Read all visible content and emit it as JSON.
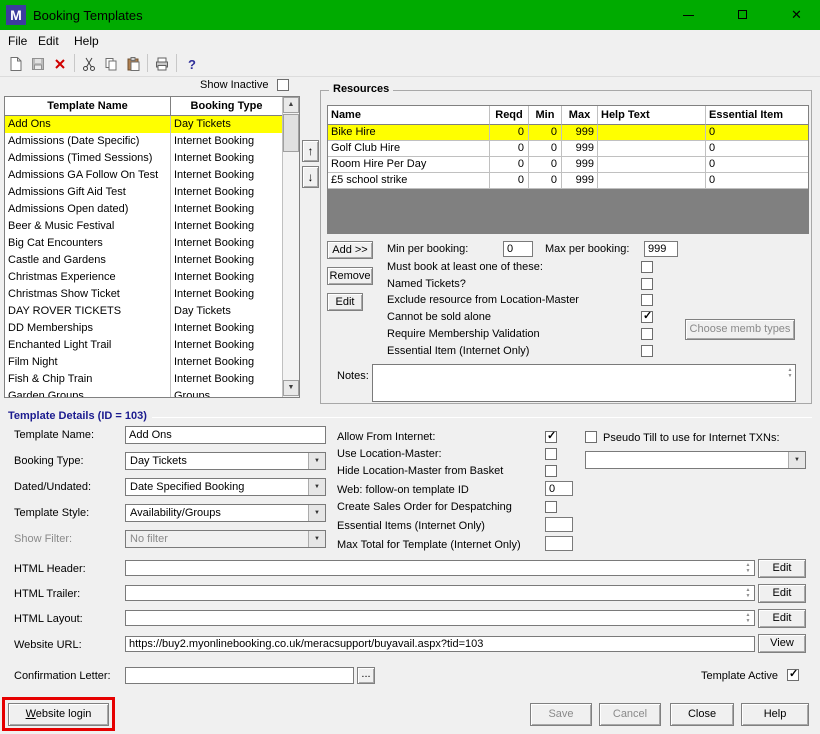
{
  "window": {
    "title": "Booking Templates",
    "logo_letter": "M"
  },
  "menu": {
    "items": [
      {
        "label": "File"
      },
      {
        "label": "Edit"
      },
      {
        "label": "Help"
      }
    ]
  },
  "toolbar": {
    "icons": [
      "new-document",
      "save",
      "delete",
      "cut",
      "copy",
      "paste",
      "print",
      "help"
    ]
  },
  "left_panel": {
    "show_inactive_label": "Show Inactive",
    "show_inactive_checked": false,
    "columns": [
      "Template Name",
      "Booking Type"
    ],
    "rows": [
      {
        "name": "Add Ons",
        "type": "Day Tickets",
        "selected": true
      },
      {
        "name": "Admissions (Date Specific)",
        "type": "Internet Booking"
      },
      {
        "name": "Admissions (Timed Sessions)",
        "type": "Internet Booking"
      },
      {
        "name": "Admissions GA Follow On Test",
        "type": "Internet Booking"
      },
      {
        "name": "Admissions Gift Aid Test",
        "type": "Internet Booking"
      },
      {
        "name": "Admissions Open dated)",
        "type": "Internet Booking"
      },
      {
        "name": "Beer & Music Festival",
        "type": "Internet Booking"
      },
      {
        "name": "Big Cat Encounters",
        "type": "Internet Booking"
      },
      {
        "name": "Castle and Gardens",
        "type": "Internet Booking"
      },
      {
        "name": "Christmas Experience",
        "type": "Internet Booking"
      },
      {
        "name": "Christmas Show Ticket",
        "type": "Internet Booking"
      },
      {
        "name": "DAY ROVER TICKETS",
        "type": "Day Tickets"
      },
      {
        "name": "DD Memberships",
        "type": "Internet Booking"
      },
      {
        "name": "Enchanted Light Trail",
        "type": "Internet Booking"
      },
      {
        "name": "Film Night",
        "type": "Internet Booking"
      },
      {
        "name": "Fish & Chip Train",
        "type": "Internet Booking"
      },
      {
        "name": "Garden Groups",
        "type": "Groups"
      }
    ]
  },
  "resources": {
    "title": "Resources",
    "headers": [
      "Name",
      "Reqd",
      "Min",
      "Max",
      "Help Text",
      "Essential Item"
    ],
    "rows": [
      [
        "Bike Hire",
        "0",
        "0",
        "999",
        "",
        "0"
      ],
      [
        "Golf Club Hire",
        "0",
        "0",
        "999",
        "",
        "0"
      ],
      [
        "Room Hire Per Day",
        "0",
        "0",
        "999",
        "",
        "0"
      ],
      [
        "£5 school strike",
        "0",
        "0",
        "999",
        "",
        "0"
      ]
    ],
    "selected_row": "Bike Hire",
    "add_button": "Add >>",
    "remove_button": "Remove",
    "edit_button": "Edit",
    "min_per_booking": {
      "label": "Min per booking:",
      "value": "0"
    },
    "max_per_booking": {
      "label": "Max per booking:",
      "value": "999"
    },
    "checkboxes": {
      "must_book": {
        "label": "Must book at least one of these:",
        "checked": false
      },
      "named_tickets": {
        "label": "Named Tickets?",
        "checked": false
      },
      "exclude_resource": {
        "label": "Exclude resource from Location-Master",
        "checked": false
      },
      "cannot_be_sold": {
        "label": "Cannot be sold alone",
        "checked": true
      },
      "require_membership": {
        "label": "Require Membership Validation",
        "checked": false
      },
      "essential_item": {
        "label": "Essential Item (Internet Only)",
        "checked": false
      }
    },
    "choose_memb_button": "Choose memb types",
    "notes_label": "Notes:",
    "notes_value": ""
  },
  "details": {
    "section_title": "Template Details (ID = 103)",
    "template_name": {
      "label": "Template Name:",
      "value": "Add Ons"
    },
    "booking_type": {
      "label": "Booking Type:",
      "value": "Day Tickets"
    },
    "dated": {
      "label": "Dated/Undated:",
      "value": "Date Specified Booking"
    },
    "style": {
      "label": "Template Style:",
      "value": "Availability/Groups"
    },
    "filter": {
      "label": "Show Filter:",
      "value": "No filter"
    },
    "allow_internet": {
      "label": "Allow From Internet:",
      "checked": true
    },
    "use_location": {
      "label": "Use Location-Master:",
      "checked": false
    },
    "hide_location": {
      "label": "Hide Location-Master from Basket",
      "checked": false
    },
    "web_follow": {
      "label": "Web: follow-on template ID",
      "value": "0"
    },
    "create_sales": {
      "label": "Create Sales Order for Despatching",
      "checked": false
    },
    "essential_items": {
      "label": "Essential Items (Internet Only)",
      "value": ""
    },
    "max_total": {
      "label": "Max Total for Template (Internet Only)",
      "value": ""
    },
    "pseudo_till": {
      "label": "Pseudo Till to use for Internet TXNs:",
      "checked": false,
      "value": ""
    },
    "html_header": {
      "label": "HTML Header:",
      "value": ""
    },
    "html_trailer": {
      "label": "HTML Trailer:",
      "value": ""
    },
    "html_layout": {
      "label": "HTML Layout:",
      "value": ""
    },
    "website_url": {
      "label": "Website URL:",
      "value": "https://buy2.myonlinebooking.co.uk/meracsupport/buyavail.aspx?tid=103"
    },
    "edit_button": "Edit",
    "view_button": "View",
    "confirmation": {
      "label": "Confirmation Letter:",
      "value": ""
    },
    "browse_button": "...",
    "template_active": {
      "label": "Template Active",
      "checked": true
    }
  },
  "footer": {
    "website_login": "Website login",
    "save": "Save",
    "cancel": "Cancel",
    "close": "Close",
    "help": "Help"
  }
}
